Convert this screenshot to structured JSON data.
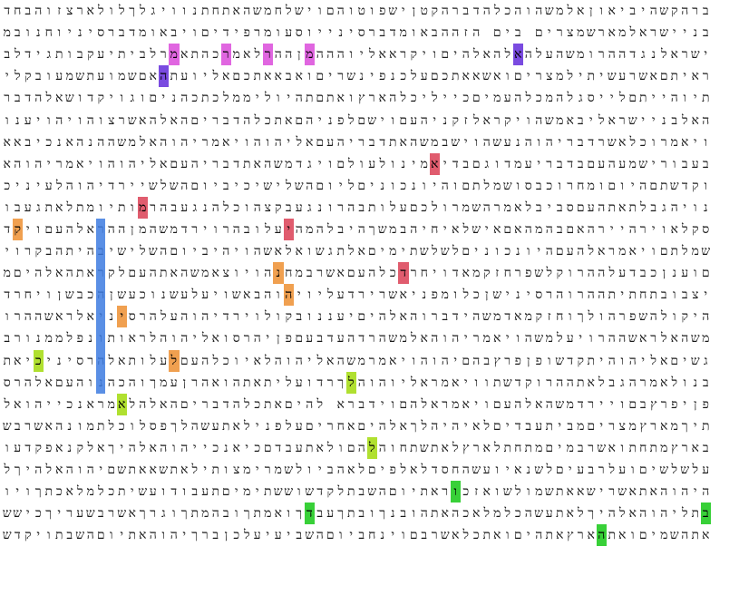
{
  "rows": [
    "תהטעבכלבעתאתהדברהקשהיביאוןאלמשהוהכלהדברהקטןישפוטוהםוישלחמשהאתחתנוויגלךלולארצזוהבחד",
    "שהשליישלאבתבניישראלמארשמצרים בים הזההבאומדברסינייוסעומרפידיםויבאומדברסיניוחנובמ",
    "דברויוזןשםישראלנגדההרומשהעלהאלהאלהיםויקראאליוהההמןההרלאמרכהתאמרלביתיעקבותגידלב",
    "ניישראלאתםראיתםאשרעשיתילמצריםואשאאתכםעלכנפינשריםואבאאתכםאליועתהאםשמועתשמעובקלי",
    "ושמרתםאתבריתיוהייתםלייסגלהמכלהעמיםכייליכלהארץואתםתהיוליממלכתכהניםוגויקדושאלהדבר",
    "יםאשרתדברהאלבניישראליבאמשהויקראלזקניהעםוישםלפניהםאתכלהדבריםהאלהאשרצוהויהויענו",
    "וכלהעםיחדוויאמרוכלאשרדבריהוהנעשהוישבמשהאתדבריהעםאליהוהויאמריהוהאלמשההנהאנכיבאא",
    "לידבעבהעןבעבורישמעהעםבדבריעמדוגםבדיאמינולעולםויגדמשהאתדבריהעםאליהוהויאמריהוהא",
    "למשהלךאלהעםוקדשתםהיוםומחרוכבסושמלתםוהיונכוניםליוםהשלישיכיביוםהשלשיירדיהוהלעיניכ",
    "להעםעלהרסינויהגבלתאתהעםסביבלאמרהשמרולכםעלותבהרונגעבקצהוכלהנגעבהרמותיומתלאתגעבו",
    "ידכיסקוליסקלאוירהיירהאםבהמהאםאישלאיחיהבמשךהיבלהמהיעלובהרוירדמשהמןההראלהעםויקד",
    "אתהעםויכבסושמלתםויאמראלהעםהיונכוניםלשלשתימיםאלתגשואלאשהויהיביוםהשלישיבהיתהבקרוי",
    "היקלתוברקיםוענןכבדעלההרוקלשפרחזקמאדויחרדכלהעםאשרבמחנהויוצאמשהאתהעםלקראתהאלהיםמ",
    "המחנהויתיצבובתחתיתההרוהרסינישןכלומפניאשרירדעליויהוהבאשויעלעשנוכעשןהכבשןויחרד",
    "כלההרמאדויהיקולהשפרהולךוחזקמאדמשהידברוהאלהיםיעננובקולוירדיהוהעלהרסיניאלראשההרו",
    "יקראיהוהלמשהאלראשההרויעלמשהויאמריהוהאלמשהרדהעדבעםפןיהרסואליהוהלראותונפלממנורב",
    "וגםהכהנוהנגשיםאליהוהיתקדשופןפרץבהםיהוהויאמרמשהאליהוהלאיוכלהעםלעלותאלהרסיניכיאת",
    "ההעדתהבנולאמרהגבלאתההרוקדשתוויאמראליוהוהלךרדועליתאתהואהרןעמךוהכהנוהעםאלהרס",
    "ולעלתאליהוהפןיפרץבםויירדמשהאלהעםויאמראלהםוידברא להיםאתכלהדבריםהאלהלאמראנכייהואל",
    "היךאשרהוצאתיךמארץמצריםמביתעבדיםלאיהיהלךאלהיםאחריםעלפנילאתעשהלךפסלוכלתמונהאשרבש",
    "מיםממעלואשרבארץמתחתואשרבמיםמתחתלארץלאתשתחוהלהםולאתעבדםכיאנכייהוהאלהיךאלקנאפקדעו",
    "ןאבתעלבניםעלשלשיםועלרבעיםלשנאיועשהחסדלאלפיםלאהביולשמרימצותילאתשאאתשםיהוהאלהיךל",
    "שואכילאינקהיהוהאתאשרישאאתשמולשואזכוראתיוםהשבתלקדשוששתימיםתעבודועשיתכלמלאכתךויו",
    "םהשביעישבתליהוהאלהיךלאתעשהכלמלאכהאתהובנךובתךעבדךואמתךובהמתךוגרךאשרבשעריךכישש",
    "ימיםעשהיהוהאתהשמיםואתהארץאתהיםואתכלאשרבםוינחביוםהשביעיעלכןברךיהוהאתיוםהשבתויקדש"
  ],
  "highlights": [
    {
      "row": 2,
      "col": 16,
      "color": "#e066e0"
    },
    {
      "row": 2,
      "col": 21,
      "color": "#e066e0"
    },
    {
      "row": 2,
      "col": 25,
      "color": "#e066e0"
    },
    {
      "row": 2,
      "col": 29,
      "color": "#e066e0"
    },
    {
      "row": 2,
      "col": 49,
      "color": "#7a4be0"
    },
    {
      "row": 3,
      "col": 15,
      "color": "#7a4be0"
    },
    {
      "row": 7,
      "col": 41,
      "color": "#e05c6e"
    },
    {
      "row": 9,
      "col": 13,
      "color": "#e05c6e"
    },
    {
      "row": 10,
      "col": 1,
      "color": "#f0a050"
    },
    {
      "row": 10,
      "col": 27,
      "color": "#e05c6e"
    },
    {
      "row": 12,
      "col": 26,
      "color": "#f0a050"
    },
    {
      "row": 12,
      "col": 38,
      "color": "#e05c6e"
    },
    {
      "row": 13,
      "col": 27,
      "color": "#f0a050"
    },
    {
      "row": 14,
      "col": 11,
      "color": "#f0a050"
    },
    {
      "row": 16,
      "col": 16,
      "color": "#f0a050"
    },
    {
      "row": 16,
      "col": 3,
      "color": "#b0e030"
    },
    {
      "row": 17,
      "col": 33,
      "color": "#b0e030"
    },
    {
      "row": 18,
      "col": 11,
      "color": "#b0e030"
    },
    {
      "row": 20,
      "col": 35,
      "color": "#b0e030"
    },
    {
      "row": 22,
      "col": 43,
      "color": "#38d038"
    },
    {
      "row": 23,
      "col": 67,
      "color": "#38d038"
    },
    {
      "row": 23,
      "col": 29,
      "color": "#38d038"
    },
    {
      "row": 24,
      "col": 57,
      "color": "#38d038"
    }
  ],
  "vertical_bar": {
    "col": 9,
    "row_start": 10,
    "row_end": 17,
    "color": "#3d7be0"
  }
}
